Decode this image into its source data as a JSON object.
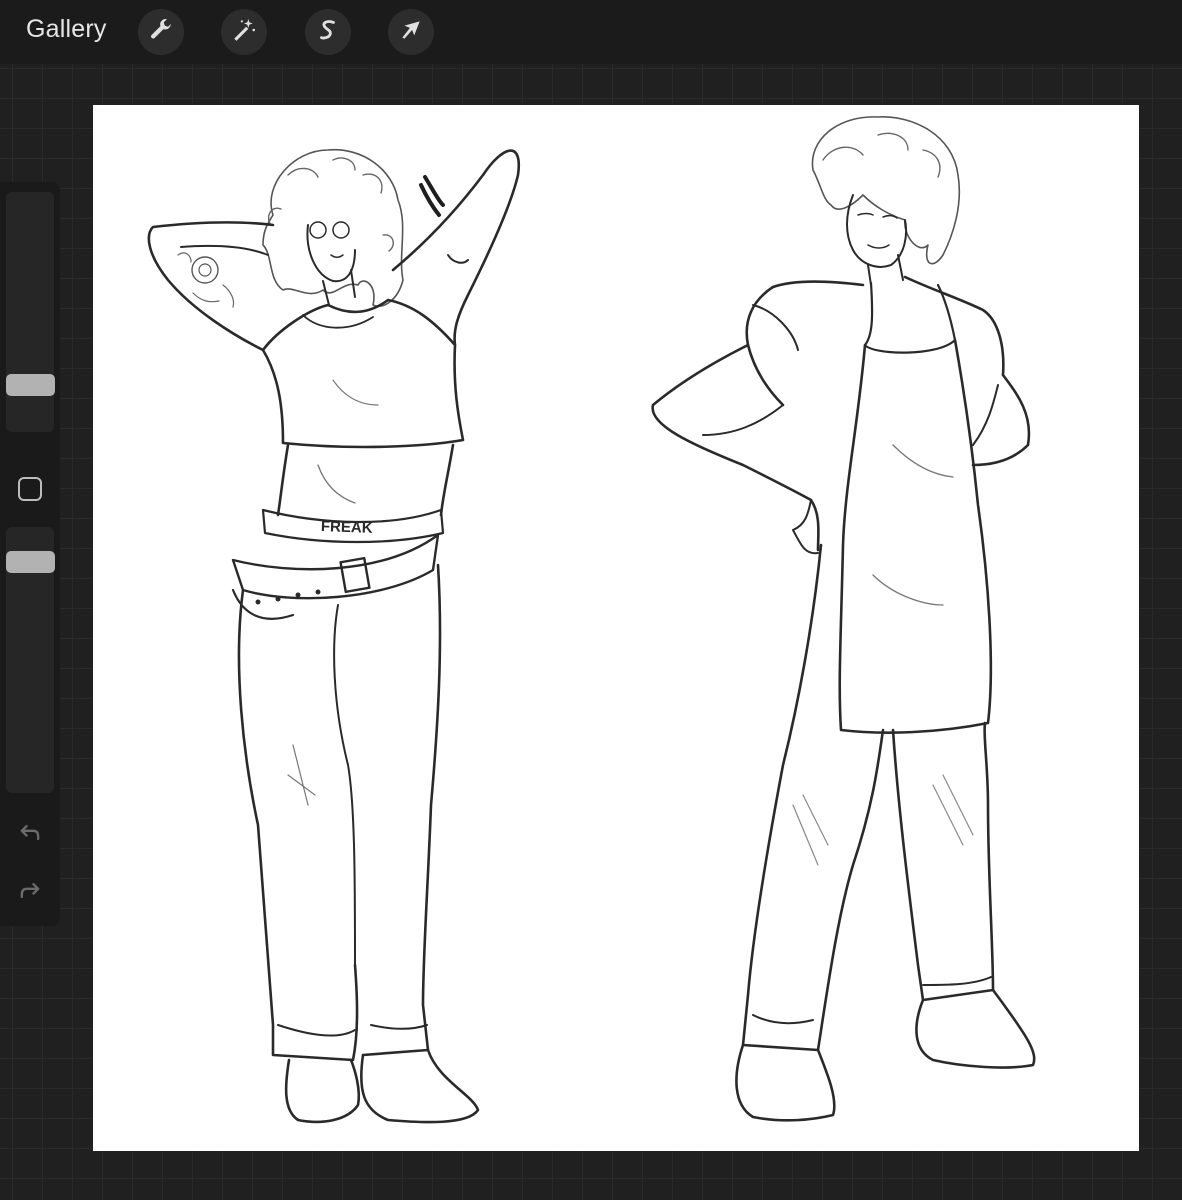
{
  "toolbar": {
    "gallery_label": "Gallery",
    "tools": [
      {
        "icon": "wrench-icon",
        "name": "actions"
      },
      {
        "icon": "magic-wand-icon",
        "name": "adjustments"
      },
      {
        "icon": "selection-s-icon",
        "name": "selection"
      },
      {
        "icon": "arrow-cursor-icon",
        "name": "transform"
      }
    ]
  },
  "sidebar": {
    "brush_size_level": 0.77,
    "opacity_level": 0.0,
    "icons": [
      "undo-icon",
      "redo-icon"
    ]
  },
  "canvas": {
    "belt_text": "FREAK",
    "background": "#ffffff",
    "line_color": "#2a2a2a"
  },
  "colors": {
    "topbar": "#1b1b1b",
    "workspace": "#202020",
    "grid_line": "#2a2a2a",
    "slider_thumb": "#b2b2b2"
  }
}
